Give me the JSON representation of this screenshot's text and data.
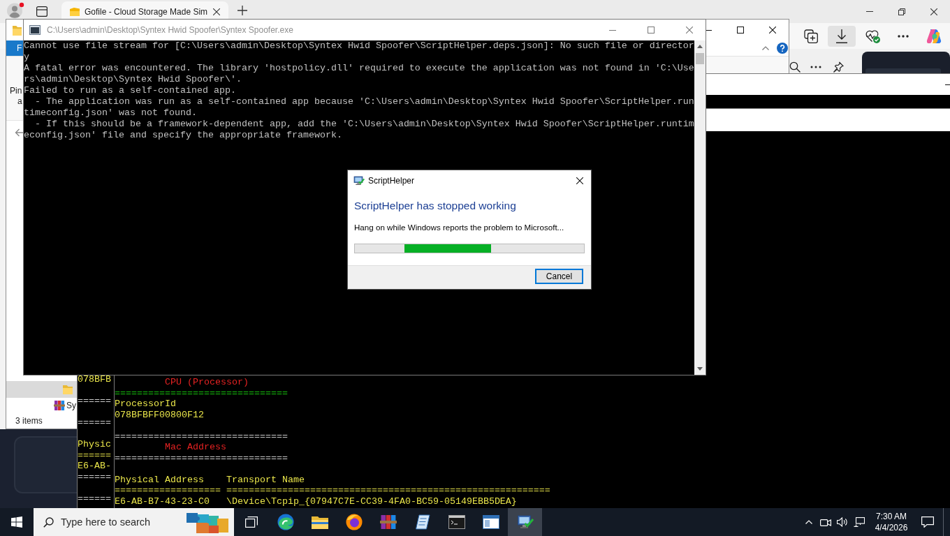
{
  "browser": {
    "tabs": [
      {
        "title": "Gofile - Cloud Storage Made Sim",
        "selected": true
      }
    ],
    "toolbar": [
      {
        "kind": "collections",
        "selected": false
      },
      {
        "kind": "downloads",
        "selected": true
      },
      {
        "kind": "health",
        "selected": false
      },
      {
        "kind": "more",
        "selected": false
      },
      {
        "kind": "copilot",
        "selected": false
      }
    ]
  },
  "explorer": {
    "ribbon_tab": "F",
    "ribbon_labels": [
      "Pin",
      "a"
    ],
    "nav_items": [
      {
        "kind": "folder",
        "selected": true
      },
      {
        "kind": "archive",
        "label": "Sy",
        "selected": false
      }
    ],
    "status": "3 items"
  },
  "console": {
    "title": "C:\\Users\\admin\\Desktop\\Syntex Hwid Spoofer\\Syntex Spoofer.exe",
    "lines": [
      "Cannot use file stream for [C:\\Users\\admin\\Desktop\\Syntex Hwid Spoofer\\ScriptHelper.deps.json]: No such file or director",
      "y",
      "A fatal error was encountered. The library 'hostpolicy.dll' required to execute the application was not found in 'C:\\Use",
      "rs\\admin\\Desktop\\Syntex Hwid Spoofer\\'.",
      "Failed to run as a self-contained app.",
      "  - The application was run as a self-contained app because 'C:\\Users\\admin\\Desktop\\Syntex Hwid Spoofer\\ScriptHelper.run",
      "timeconfig.json' was not found.",
      "  - If this should be a framework-dependent app, add the 'C:\\Users\\admin\\Desktop\\Syntex Hwid Spoofer\\ScriptHelper.runtim",
      "econfig.json' file and specify the appropriate framework."
    ]
  },
  "back_console": {
    "blocks": [
      [
        {
          "kind": "text",
          "text": "078BFB",
          "color": "#e9e54a"
        }
      ],
      [
        {
          "kind": "text",
          "text": "======",
          "color": "#cccccc"
        }
      ],
      [
        {
          "kind": "text",
          "text": "======",
          "color": "#cccccc"
        }
      ],
      [
        {
          "kind": "text",
          "text": "Physic",
          "color": "#e9e54a"
        },
        {
          "kind": "text",
          "text": "======",
          "color": "#e9e54a"
        },
        {
          "kind": "text",
          "text": "E6-AB-",
          "color": "#e9e54a"
        },
        {
          "kind": "text",
          "text": "======",
          "color": "#cccccc"
        }
      ],
      [
        {
          "kind": "text",
          "text": "======",
          "color": "#cccccc"
        }
      ]
    ]
  },
  "front_console": {
    "blocks": [
      [
        {
          "kind": "heading",
          "text": "CPU (Processor)",
          "color": "#e52222"
        },
        {
          "kind": "text",
          "text": "===============================",
          "color": "#16c60c"
        },
        {
          "kind": "text",
          "text": "ProcessorId",
          "color": "#e9e54a"
        },
        {
          "kind": "text",
          "text": "078BFBFF00800F12",
          "color": "#e9e54a"
        }
      ],
      [
        {
          "kind": "text",
          "text": "===============================",
          "color": "#cccccc"
        },
        {
          "kind": "heading",
          "text": "Mac Address",
          "color": "#e52222"
        },
        {
          "kind": "text",
          "text": "===============================",
          "color": "#cccccc"
        }
      ],
      [
        {
          "kind": "text",
          "text": "Physical Address    Transport Name",
          "color": "#e9e54a"
        },
        {
          "kind": "text",
          "text": "=================== ==========================================================",
          "color": "#e9e54a"
        },
        {
          "kind": "text",
          "text": "E6-AB-B7-43-23-C0   \\Device\\Tcpip_{07947C7E-CC39-4FA0-BC59-05149EBB5DEA}",
          "color": "#e9e54a"
        }
      ]
    ]
  },
  "error_dialog": {
    "title": "ScriptHelper",
    "heading": "ScriptHelper has stopped working",
    "message": "Hang on while Windows reports the problem to Microsoft...",
    "progress": {
      "level": 0.38
    },
    "buttons": [
      {
        "label": "Cancel",
        "focused": true
      }
    ]
  },
  "taskbar": {
    "search": {
      "placeholder": "Type here to search"
    },
    "apps": [
      {
        "kind": "task-view",
        "active": false
      },
      {
        "kind": "edge",
        "active": false
      },
      {
        "kind": "explorer",
        "active": false
      },
      {
        "kind": "firefox",
        "active": false
      },
      {
        "kind": "winrar",
        "active": false
      },
      {
        "kind": "journal",
        "active": false
      },
      {
        "kind": "console",
        "active": false
      },
      {
        "kind": "window",
        "active": false
      },
      {
        "kind": "reporter",
        "active": true
      }
    ],
    "clock": {
      "time": "7:30 AM",
      "date": "4/4/2026"
    }
  }
}
